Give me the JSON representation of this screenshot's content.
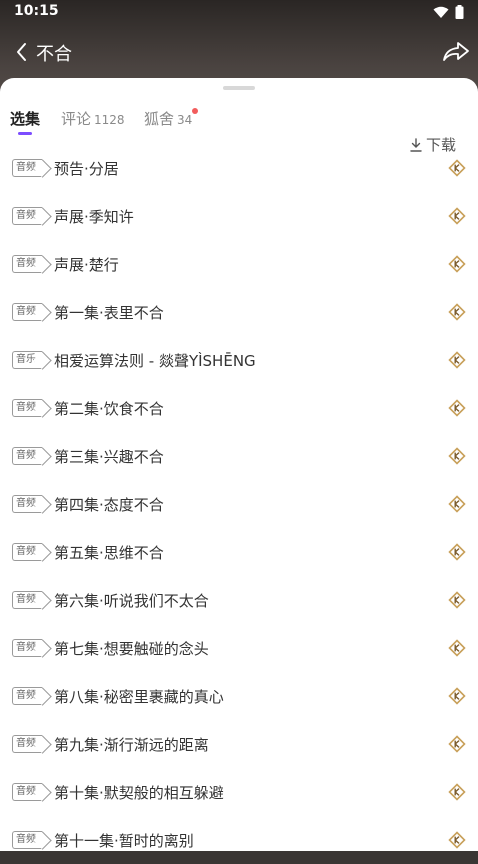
{
  "status": {
    "time": "10:15"
  },
  "header": {
    "title": "不合"
  },
  "tabs": {
    "episodes": {
      "label": "选集"
    },
    "comments": {
      "label": "评论",
      "count": "1128"
    },
    "group": {
      "label": "狐舍",
      "count": "34"
    },
    "download": {
      "label": "下载"
    }
  },
  "episodes": [
    {
      "tag": "音频",
      "title": "预告·分居"
    },
    {
      "tag": "音频",
      "title": "声展·季知许"
    },
    {
      "tag": "音频",
      "title": "声展·楚行"
    },
    {
      "tag": "音频",
      "title": "第一集·表里不合"
    },
    {
      "tag": "音乐",
      "title": "相爱运算法则 - 燚聲YÌSHĒNG"
    },
    {
      "tag": "音频",
      "title": "第二集·饮食不合"
    },
    {
      "tag": "音频",
      "title": "第三集·兴趣不合"
    },
    {
      "tag": "音频",
      "title": "第四集·态度不合"
    },
    {
      "tag": "音频",
      "title": "第五集·思维不合"
    },
    {
      "tag": "音频",
      "title": "第六集·听说我们不太合"
    },
    {
      "tag": "音频",
      "title": "第七集·想要触碰的念头"
    },
    {
      "tag": "音频",
      "title": "第八集·秘密里裹藏的真心"
    },
    {
      "tag": "音频",
      "title": "第九集·渐行渐远的距离"
    },
    {
      "tag": "音频",
      "title": "第十集·默契般的相互躲避"
    },
    {
      "tag": "音频",
      "title": "第十一集·暂时的离别"
    }
  ],
  "colors": {
    "accent": "#7c4dff",
    "badge_dot": "#f25c5c",
    "vip_icon": "#c8a05a"
  }
}
